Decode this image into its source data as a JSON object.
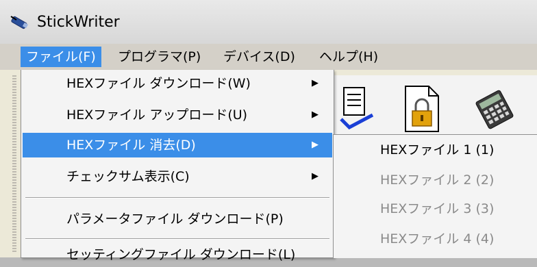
{
  "window": {
    "title": "StickWriter"
  },
  "menubar": [
    {
      "label": "ファイル(F)"
    },
    {
      "label": "プログラマ(P)"
    },
    {
      "label": "デバイス(D)"
    },
    {
      "label": "ヘルプ(H)"
    }
  ],
  "file_menu": {
    "items": [
      {
        "label": "HEXファイル ダウンロード(W)",
        "has_submenu": true
      },
      {
        "label": "HEXファイル アップロード(U)",
        "has_submenu": true
      },
      {
        "label": "HEXファイル 消去(D)",
        "has_submenu": true,
        "highlighted": true
      },
      {
        "label": "チェックサム表示(C)",
        "has_submenu": true
      },
      {
        "label": "パラメータファイル ダウンロード(P)",
        "has_submenu": false
      },
      {
        "label": "セッティングファイル ダウンロード(L)",
        "has_submenu": false
      }
    ],
    "submenu_arrow": "▶"
  },
  "erase_submenu": {
    "items": [
      {
        "label": "HEXファイル 1 (1)",
        "enabled": true
      },
      {
        "label": "HEXファイル 2 (2)",
        "enabled": false
      },
      {
        "label": "HEXファイル 3 (3)",
        "enabled": false
      },
      {
        "label": "HEXファイル 4 (4)",
        "enabled": false
      }
    ]
  },
  "toolbar": {
    "buttons": [
      {
        "icon": "verify-document-icon"
      },
      {
        "icon": "lock-document-icon"
      },
      {
        "icon": "calculator-icon"
      }
    ]
  },
  "colors": {
    "highlight": "#3b8ee8",
    "menu_bg": "#f4f4f4",
    "disabled_text": "#8a8a8a"
  }
}
